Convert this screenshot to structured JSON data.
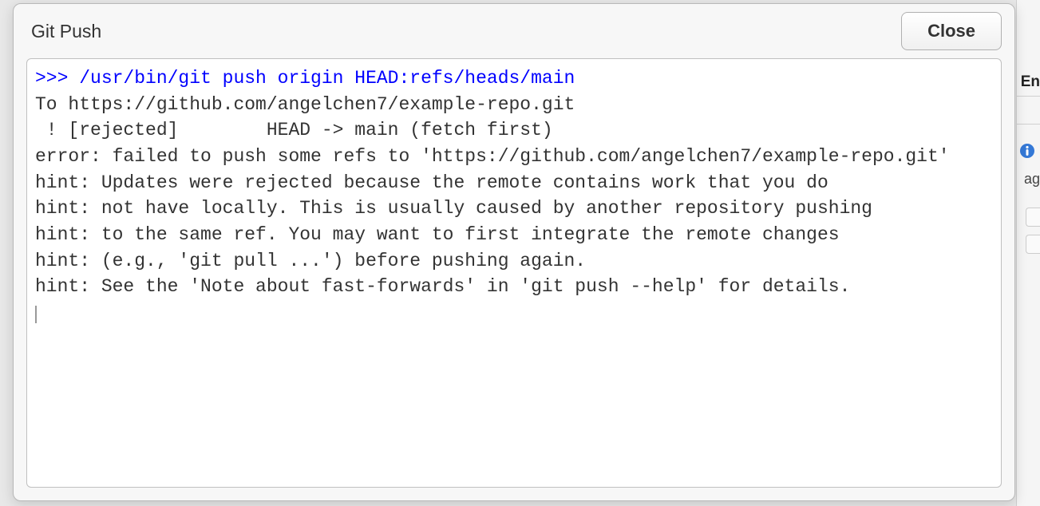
{
  "dialog": {
    "title": "Git Push",
    "close_label": "Close"
  },
  "output": {
    "command": ">>> /usr/bin/git push origin HEAD:refs/heads/main",
    "lines": [
      "To https://github.com/angelchen7/example-repo.git",
      " ! [rejected]        HEAD -> main (fetch first)",
      "error: failed to push some refs to 'https://github.com/angelchen7/example-repo.git'",
      "hint: Updates were rejected because the remote contains work that you do",
      "hint: not have locally. This is usually caused by another repository pushing",
      "hint: to the same ref. You may want to first integrate the remote changes",
      "hint: (e.g., 'git pull ...') before pushing again.",
      "hint: See the 'Note about fast-forwards' in 'git push --help' for details."
    ]
  },
  "background": {
    "partial_label_en": "En",
    "partial_label_ac": "ag"
  }
}
